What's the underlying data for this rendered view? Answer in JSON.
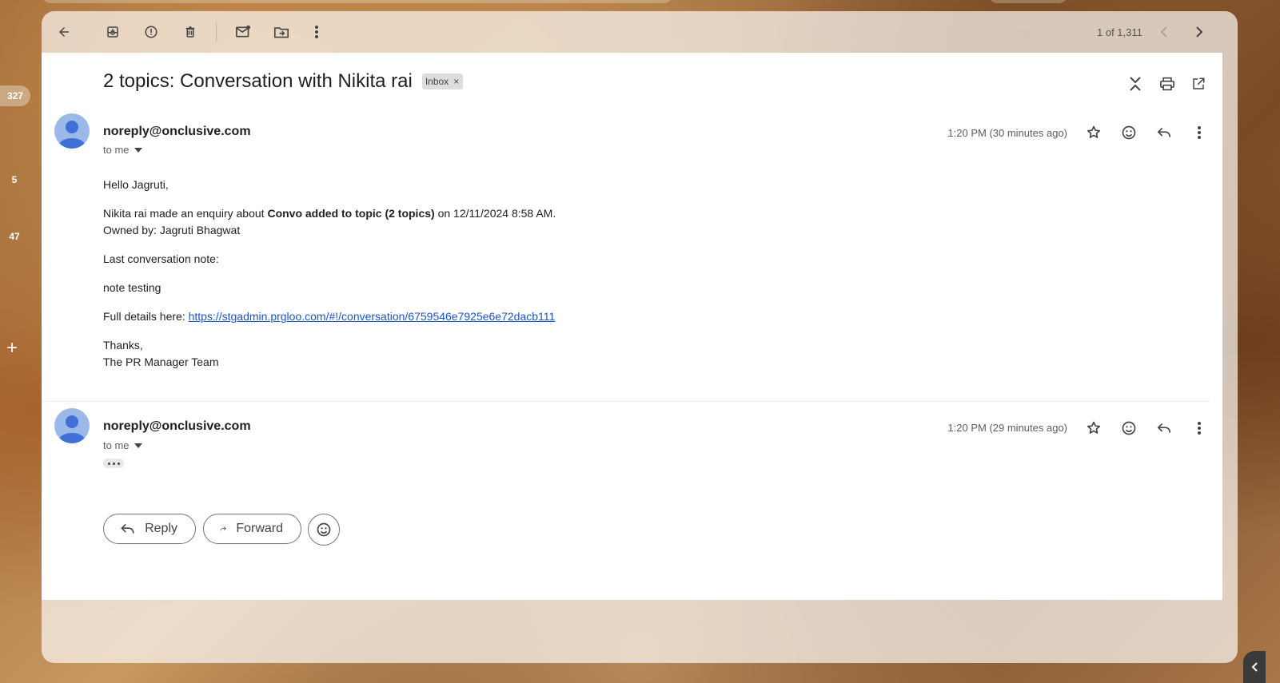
{
  "rail": {
    "badge_count": "327",
    "count_2": "5",
    "count_3": "47"
  },
  "toolbar": {
    "pager_text": "1 of 1,311"
  },
  "email": {
    "subject": "2 topics: Conversation with Nikita rai",
    "label": "Inbox",
    "label_remove": "×"
  },
  "messages": [
    {
      "sender": "noreply@onclusive.com",
      "to": "to me",
      "time": "1:20 PM (30 minutes ago)",
      "greeting": "Hello Jagruti,",
      "line1_pre": "Nikita rai made an enquiry about ",
      "line1_bold": "Convo added to topic (2 topics)",
      "line1_post": " on 12/11/2024 8:58 AM.",
      "line2": "Owned by: Jagruti Bhagwat",
      "note_label": "Last conversation note:",
      "note": "note testing",
      "details_label": "Full details here: ",
      "details_link": "https://stgadmin.prgloo.com/#!/conversation/6759546e7925e6e72dacb111",
      "signoff": "Thanks,",
      "team": "The PR Manager Team"
    },
    {
      "sender": "noreply@onclusive.com",
      "to": "to me",
      "time": "1:20 PM (29 minutes ago)"
    }
  ],
  "actions": {
    "reply": "Reply",
    "forward": "Forward"
  }
}
